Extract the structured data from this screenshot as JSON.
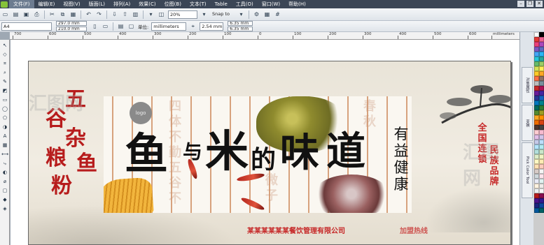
{
  "menubar": {
    "items": [
      "文件(F)",
      "编辑(E)",
      "视图(V)",
      "版面(L)",
      "排列(A)",
      "效果(C)",
      "位图(B)",
      "文本(T)",
      "Table",
      "工具(O)",
      "窗口(W)",
      "帮助(H)"
    ],
    "active_index": 0
  },
  "toolbar": {
    "zoom": "20%",
    "snap": "Snap to"
  },
  "propertybar": {
    "paper": "A4",
    "width": "297.0 mm",
    "height": "210.0 mm",
    "units_label": "单位:",
    "units": "millimeters",
    "nudge": "2.54 mm",
    "dup_x": "6.35 mm",
    "dup_y": "6.35 mm"
  },
  "ruler": {
    "ticks": [
      "700",
      "600",
      "500",
      "400",
      "300",
      "200",
      "100",
      "0",
      "100",
      "200",
      "300",
      "400",
      "500",
      "600"
    ],
    "unit": "millimeters"
  },
  "design": {
    "left_title_chars": [
      "五",
      "谷",
      "杂",
      "粮",
      "鱼",
      "粉"
    ],
    "logo": "logo",
    "title_chars": [
      "鱼",
      "与",
      "米",
      "的",
      "味",
      "道"
    ],
    "ghost_col1": [
      "四",
      "体",
      "不",
      "勤",
      "五",
      "谷",
      "不"
    ],
    "ghost_col2": [
      "春",
      "秋"
    ],
    "ghost_col3": [
      "微",
      "子"
    ],
    "side_black": [
      "有",
      "益",
      "健",
      "康"
    ],
    "right_red": [
      "全",
      "国",
      "连",
      "锁",
      "民",
      "族",
      "品",
      "牌"
    ],
    "footer": "某某某某某某餐饮管理有限公司",
    "footer_tail": "加盟热线",
    "watermark": "汇图网"
  },
  "docker": {
    "tabs": [
      "对象属性",
      "变换",
      "Pick Color Tool"
    ]
  },
  "palette": [
    "#ffffff",
    "#000000",
    "#e53935",
    "#f06292",
    "#ec407a",
    "#ab47bc",
    "#7e57c2",
    "#5c6bc0",
    "#42a5f5",
    "#29b6f6",
    "#26c6da",
    "#26a69a",
    "#66bb6a",
    "#9ccc65",
    "#d4e157",
    "#ffee58",
    "#ffca28",
    "#ffa726",
    "#ff7043",
    "#8d6e63",
    "#bdbdbd",
    "#78909c",
    "#c62828",
    "#ad1457",
    "#6a1b9a",
    "#4527a0",
    "#283593",
    "#1565c0",
    "#0277bd",
    "#00838f",
    "#00695c",
    "#2e7d32",
    "#558b2f",
    "#9e9d24",
    "#f9a825",
    "#ff8f00",
    "#ef6c00",
    "#d84315",
    "#4e342e",
    "#424242",
    "#ffcdd2",
    "#f8bbd0",
    "#e1bee7",
    "#d1c4e9",
    "#c5cae9",
    "#bbdefb",
    "#b3e5fc",
    "#b2ebf2",
    "#b2dfdb",
    "#c8e6c9",
    "#dcedc8",
    "#f0f4c3",
    "#fff9c4",
    "#ffecb3",
    "#ffe0b2",
    "#ffccbc",
    "#d7ccc8",
    "#f5f5f5",
    "#cfd8dc",
    "#fce4ec",
    "#e8eaf6",
    "#e0f2f1",
    "#fff3e0",
    "#efebe9",
    "#eceff1",
    "#fafafa",
    "#b71c1c",
    "#880e4f",
    "#4a148c",
    "#311b92",
    "#1a237e",
    "#0d47a1",
    "#01579b",
    "#006064"
  ]
}
